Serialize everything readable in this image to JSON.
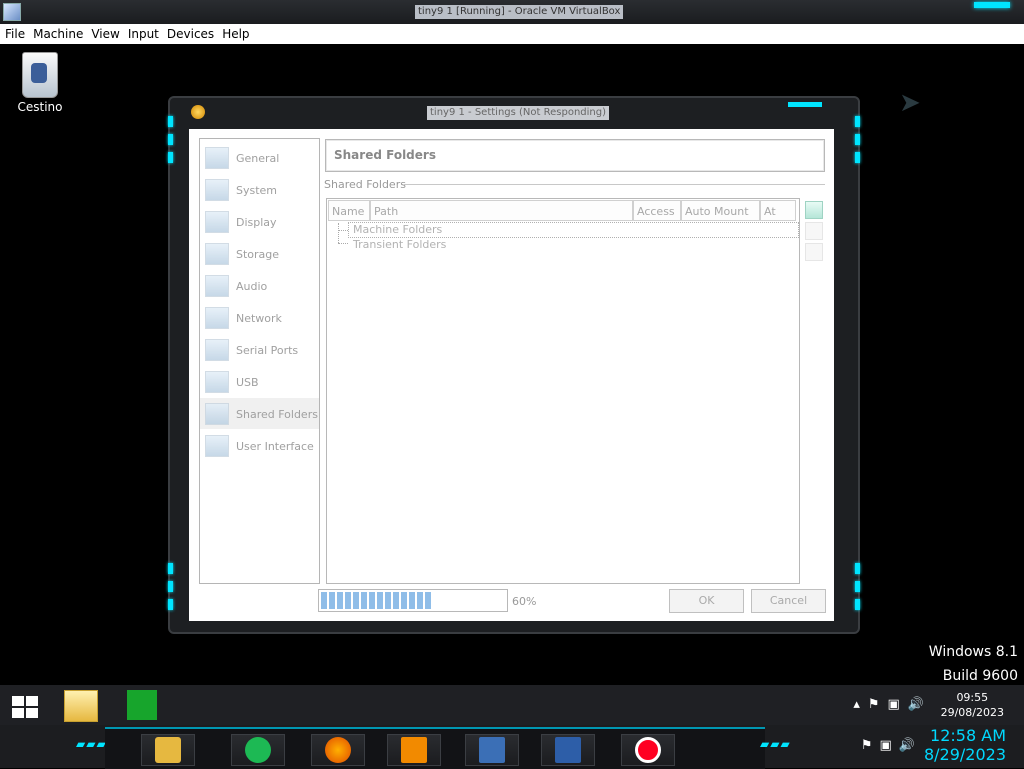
{
  "outer_window": {
    "title": "tiny9 1 [Running] - Oracle VM VirtualBox",
    "menu": [
      "File",
      "Machine",
      "View",
      "Input",
      "Devices",
      "Help"
    ]
  },
  "desktop": {
    "recycle_bin_label": "Cestino",
    "watermark_line1": "Windows 8.1",
    "watermark_line2": "Build 9600"
  },
  "dialog": {
    "title": "tiny9 1 - Settings (Not Responding)",
    "nav_items": [
      {
        "label": "General",
        "icon": "general-icon"
      },
      {
        "label": "System",
        "icon": "system-icon"
      },
      {
        "label": "Display",
        "icon": "display-icon"
      },
      {
        "label": "Storage",
        "icon": "storage-icon"
      },
      {
        "label": "Audio",
        "icon": "audio-icon"
      },
      {
        "label": "Network",
        "icon": "network-icon"
      },
      {
        "label": "Serial Ports",
        "icon": "serial-ports-icon"
      },
      {
        "label": "USB",
        "icon": "usb-icon"
      },
      {
        "label": "Shared Folders",
        "icon": "shared-folders-icon",
        "selected": true
      },
      {
        "label": "User Interface",
        "icon": "user-interface-icon"
      }
    ],
    "page_title": "Shared Folders",
    "section_label": "Shared Folders",
    "columns": [
      "Name",
      "Path",
      "Access",
      "Auto Mount",
      "At"
    ],
    "tree_rows": [
      "Machine Folders",
      "Transient Folders"
    ],
    "progress_percent": 60,
    "progress_text": "60%",
    "ok_label": "OK",
    "cancel_label": "Cancel"
  },
  "taskbar": {
    "time": "09:55",
    "date": "29/08/2023",
    "dock_time": "12:58 AM",
    "dock_date": "8/29/2023"
  },
  "colors": {
    "accent": "#00e5ff",
    "progress": "#8fbde8"
  }
}
